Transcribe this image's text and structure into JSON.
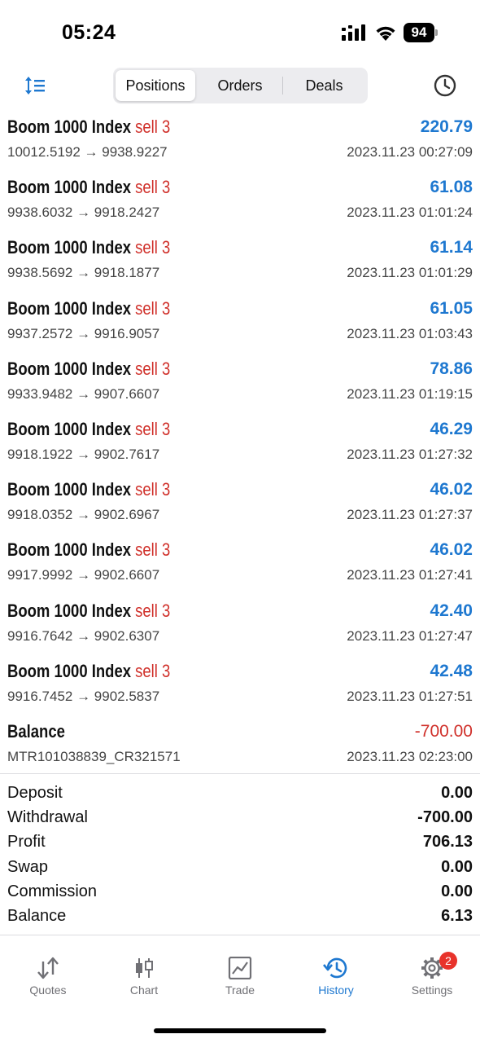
{
  "status_bar": {
    "time": "05:24",
    "battery": "94"
  },
  "toolbar": {
    "segments": [
      {
        "label": "Positions",
        "active": true
      },
      {
        "label": "Orders",
        "active": false
      },
      {
        "label": "Deals",
        "active": false
      }
    ],
    "sort_icon": "sort-icon",
    "history_icon": "clock-icon",
    "accent_color": "#1e78d0"
  },
  "deals": [
    {
      "symbol": "Boom 1000 Index",
      "type": "sell 3",
      "prices": "10012.5192 → 9938.9227",
      "profit": "220.79",
      "time": "2023.11.23 00:27:09"
    },
    {
      "symbol": "Boom 1000 Index",
      "type": "sell 3",
      "prices": "9938.6032 → 9918.2427",
      "profit": "61.08",
      "time": "2023.11.23 01:01:24"
    },
    {
      "symbol": "Boom 1000 Index",
      "type": "sell 3",
      "prices": "9938.5692 → 9918.1877",
      "profit": "61.14",
      "time": "2023.11.23 01:01:29"
    },
    {
      "symbol": "Boom 1000 Index",
      "type": "sell 3",
      "prices": "9937.2572 → 9916.9057",
      "profit": "61.05",
      "time": "2023.11.23 01:03:43"
    },
    {
      "symbol": "Boom 1000 Index",
      "type": "sell 3",
      "prices": "9933.9482 → 9907.6607",
      "profit": "78.86",
      "time": "2023.11.23 01:19:15"
    },
    {
      "symbol": "Boom 1000 Index",
      "type": "sell 3",
      "prices": "9918.1922 → 9902.7617",
      "profit": "46.29",
      "time": "2023.11.23 01:27:32"
    },
    {
      "symbol": "Boom 1000 Index",
      "type": "sell 3",
      "prices": "9918.0352 → 9902.6967",
      "profit": "46.02",
      "time": "2023.11.23 01:27:37"
    },
    {
      "symbol": "Boom 1000 Index",
      "type": "sell 3",
      "prices": "9917.9992 → 9902.6607",
      "profit": "46.02",
      "time": "2023.11.23 01:27:41"
    },
    {
      "symbol": "Boom 1000 Index",
      "type": "sell 3",
      "prices": "9916.7642 → 9902.6307",
      "profit": "42.40",
      "time": "2023.11.23 01:27:47"
    },
    {
      "symbol": "Boom 1000 Index",
      "type": "sell 3",
      "prices": "9916.7452 → 9902.5837",
      "profit": "42.48",
      "time": "2023.11.23 01:27:51"
    },
    {
      "symbol": "Balance",
      "type": "",
      "prices": "MTR101038839_CR321571",
      "profit": "-700.00",
      "time": "2023.11.23 02:23:00",
      "negative": true
    }
  ],
  "summary": [
    {
      "label": "Deposit",
      "value": "0.00"
    },
    {
      "label": "Withdrawal",
      "value": "-700.00"
    },
    {
      "label": "Profit",
      "value": "706.13"
    },
    {
      "label": "Swap",
      "value": "0.00"
    },
    {
      "label": "Commission",
      "value": "0.00"
    },
    {
      "label": "Balance",
      "value": "6.13"
    }
  ],
  "tabbar": [
    {
      "label": "Quotes",
      "icon": "quotes-arrows-icon",
      "active": false
    },
    {
      "label": "Chart",
      "icon": "candlestick-icon",
      "active": false
    },
    {
      "label": "Trade",
      "icon": "trade-chart-icon",
      "active": false
    },
    {
      "label": "History",
      "icon": "history-icon",
      "active": true
    },
    {
      "label": "Settings",
      "icon": "gear-icon",
      "active": false,
      "badge": "2"
    }
  ]
}
